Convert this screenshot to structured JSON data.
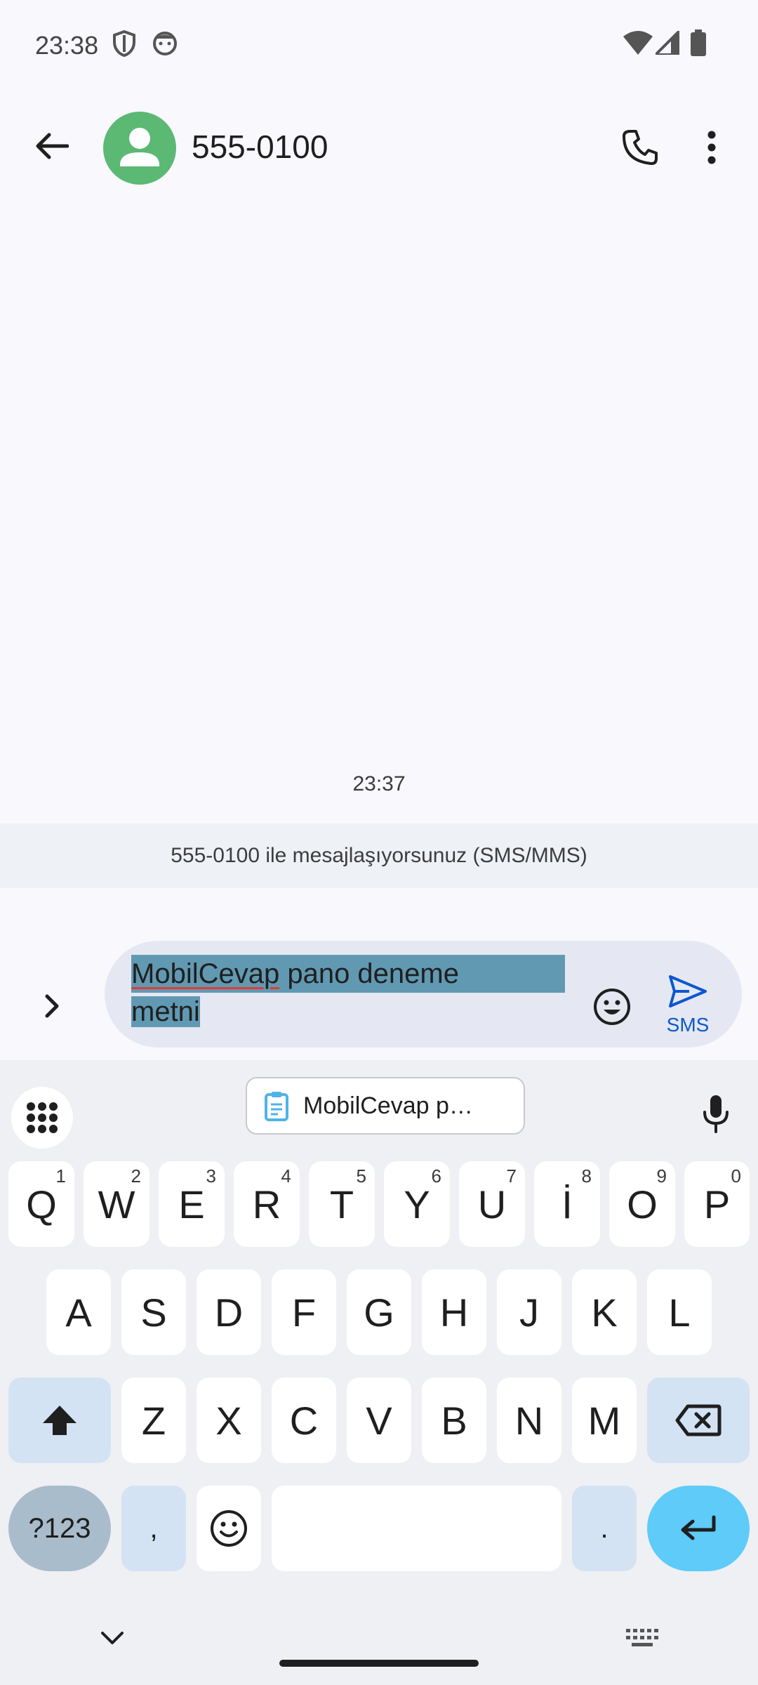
{
  "status_bar": {
    "time": "23:38"
  },
  "header": {
    "contact": "555-0100"
  },
  "conversation": {
    "timestamp": "23:37",
    "info": "555-0100 ile mesajlaşıyorsunuz (SMS/MMS)"
  },
  "compose": {
    "text_part1": "MobilCevap",
    "text_part2": " pano deneme",
    "text_part3": "metni",
    "send_label": "SMS"
  },
  "keyboard": {
    "clipboard_suggestion": "MobilCevap p…",
    "row1": [
      {
        "l": "Q",
        "h": "1"
      },
      {
        "l": "W",
        "h": "2"
      },
      {
        "l": "E",
        "h": "3"
      },
      {
        "l": "R",
        "h": "4"
      },
      {
        "l": "T",
        "h": "5"
      },
      {
        "l": "Y",
        "h": "6"
      },
      {
        "l": "U",
        "h": "7"
      },
      {
        "l": "İ",
        "h": "8"
      },
      {
        "l": "O",
        "h": "9"
      },
      {
        "l": "P",
        "h": "0"
      }
    ],
    "row2": [
      "A",
      "S",
      "D",
      "F",
      "G",
      "H",
      "J",
      "K",
      "L"
    ],
    "row3": [
      "Z",
      "X",
      "C",
      "V",
      "B",
      "N",
      "M"
    ],
    "sym_label": "?123",
    "comma": ",",
    "period": "."
  },
  "colors": {
    "accent": "#0b57d0",
    "avatar": "#5bb974",
    "selection": "#6199b2",
    "enter": "#5ecbf8"
  }
}
